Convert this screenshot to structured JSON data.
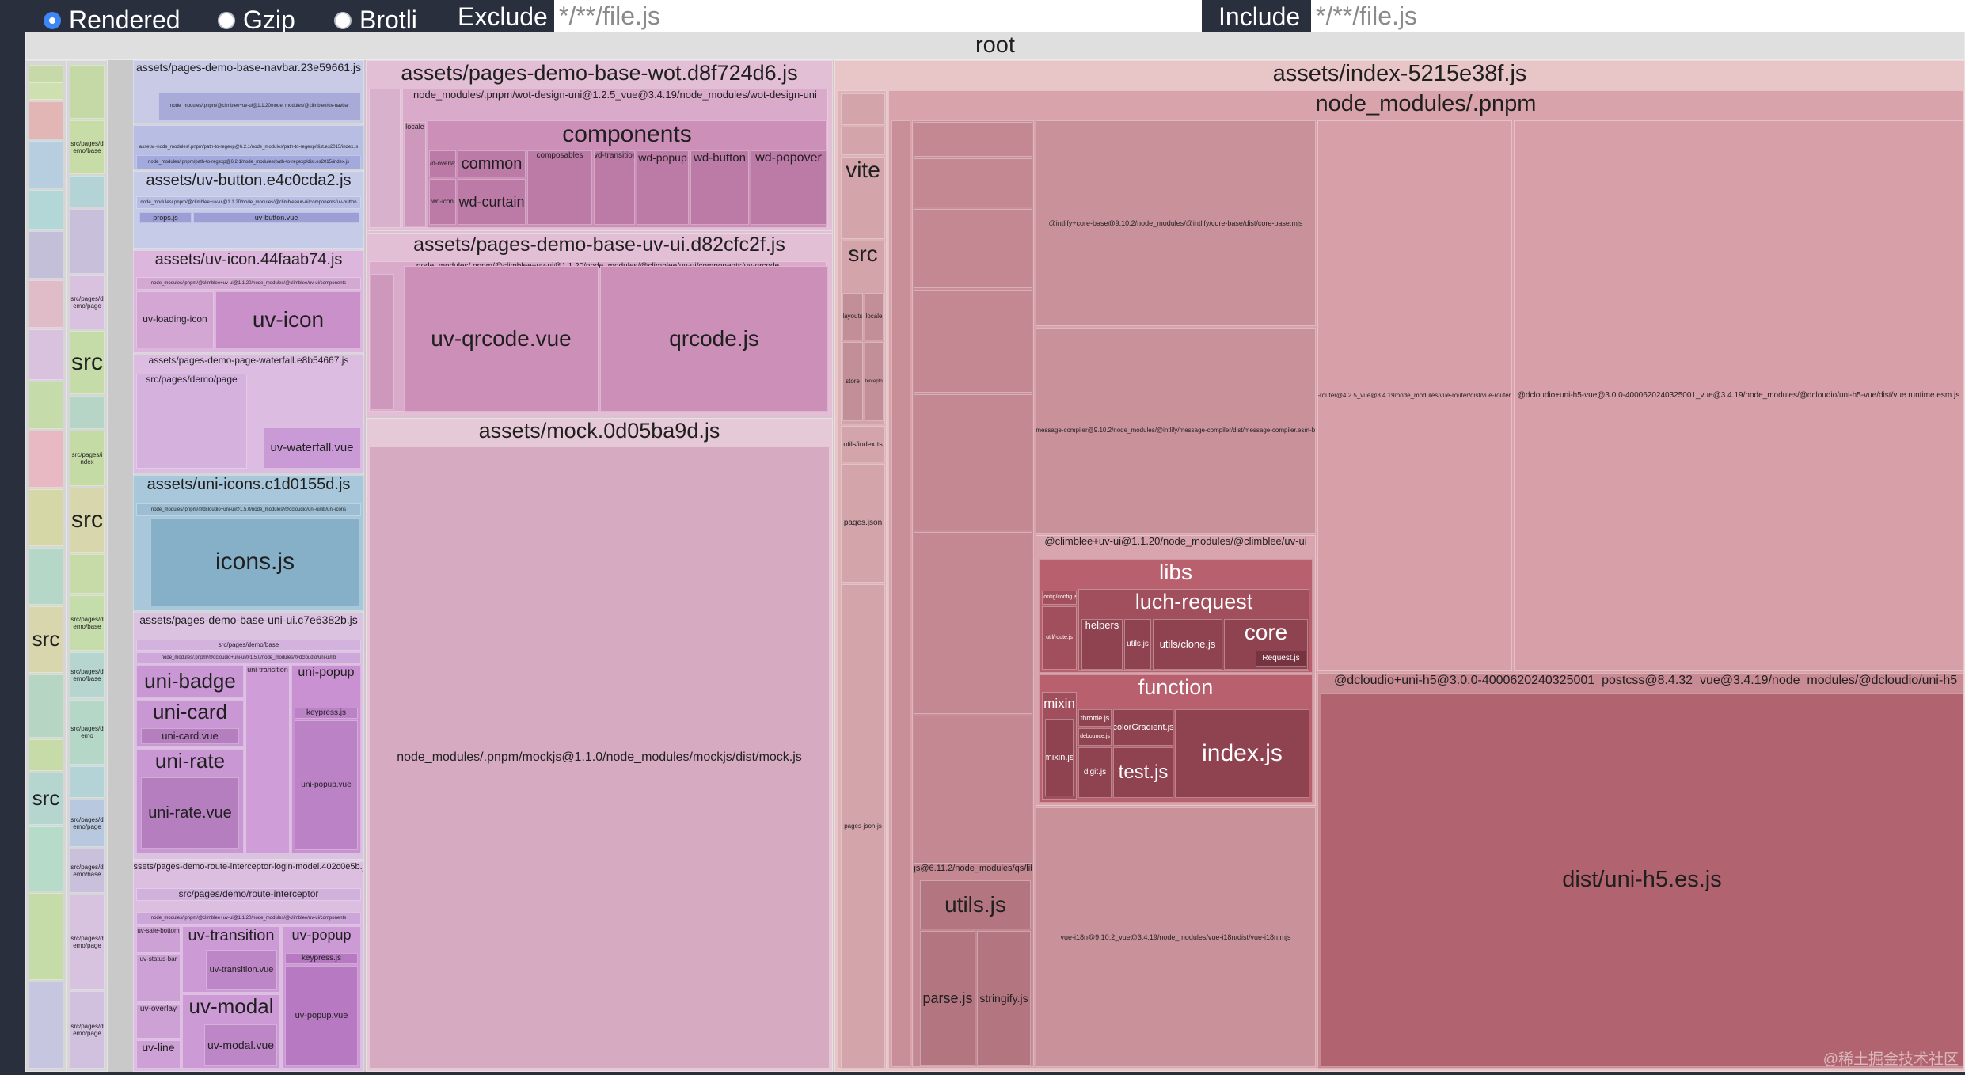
{
  "toolbar": {
    "modes": [
      {
        "label": "Rendered",
        "selected": true
      },
      {
        "label": "Gzip",
        "selected": false
      },
      {
        "label": "Brotli",
        "selected": false
      }
    ],
    "exclude_label": "Exclude",
    "exclude_placeholder": "*/**/file.js",
    "include_label": "Include",
    "include_placeholder": "*/**/file.js"
  },
  "treemap": {
    "root": "root",
    "left_columns": {
      "src_labels": [
        "src",
        "src",
        "src",
        "src"
      ],
      "col2_items": [
        "src/pages/demo/base",
        "src/pages/demo/page",
        "src/pages/index",
        "src/pages/demo/base",
        "src/pages/demo/base",
        "src/pages/demo",
        "src/pages/demo/page",
        "src/pages/demo/base",
        "src/pages/demo/page",
        "src/pages/index",
        "src/pages/demo/page"
      ]
    },
    "col3": {
      "navbar": {
        "title": "assets/pages-demo-base-navbar.23e59661.js",
        "sub1": "node_modules/.pnpm/@climblee+uv-ui@1.1.20/node_modules/@climblee/uv-navbar",
        "sub2": "assets/~node_modules/.pnpm/path-to-regexp@6.2.1/node_modules/path-to-regexp/dist.es2015/index.js",
        "sub3": "node_modules/.pnpm/path-to-regexp@6.2.1/node_modules/path-to-regexp/dist.es2015/index.js"
      },
      "uv_button": {
        "title": "assets/uv-button.e4c0cda2.js",
        "sub": "node_modules/.pnpm/@climblee+uv-ui@1.1.20/node_modules/@climblee/uv-ui/components/uv-button",
        "props": "props.js",
        "vue": "uv-button.vue"
      },
      "uv_icon": {
        "title": "assets/uv-icon.44faab74.js",
        "sub": "node_modules/.pnpm/@climblee+uv-ui@1.1.20/node_modules/@climblee/uv-ui/components",
        "loading": "uv-loading-icon",
        "icon": "uv-icon"
      },
      "waterfall": {
        "title": "assets/pages-demo-page-waterfall.e8b54667.js",
        "sub": "src/pages/demo/page",
        "item": "uv-waterfall.vue"
      },
      "uni_icons": {
        "title": "assets/uni-icons.c1d0155d.js",
        "sub": "node_modules/.pnpm/@dcloudio+uni-ui@1.5.0/node_modules/@dcloudio/uni-ui/lib/uni-icons",
        "item": "icons.js"
      },
      "uni_ui": {
        "title": "assets/pages-demo-base-uni-ui.c7e6382b.js",
        "sub": "src/pages/demo/base",
        "sub2": "node_modules/.pnpm/@dcloudio+uni-ui@1.5.0/node_modules/@dcloudio/uni-ui/lib",
        "badge": "uni-badge",
        "card": "uni-card",
        "card_vue": "uni-card.vue",
        "rate": "uni-rate",
        "rate_vue": "uni-rate.vue",
        "transition": "uni-transition",
        "popup": "uni-popup",
        "keypress": "keypress.js",
        "popup_vue": "uni-popup.vue"
      },
      "route": {
        "title": "assets/pages-demo-route-interceptor-login-model.402c0e5b.js",
        "sub": "src/pages/demo/route-interceptor",
        "sub2": "node_modules/.pnpm/@climblee+uv-ui@1.1.20/node_modules/@climblee/uv-ui/components",
        "safe": "uv-safe-bottom",
        "status": "uv-status-bar",
        "overlay": "uv-overlay",
        "line": "uv-line",
        "transition": "uv-transition",
        "transition_vue": "uv-transition.vue",
        "modal": "uv-modal",
        "modal_vue": "uv-modal.vue",
        "popup": "uv-popup",
        "keypress": "keypress.js",
        "popup_vue": "uv-popup.vue"
      }
    },
    "col4": {
      "wot": {
        "title": "assets/pages-demo-base-wot.d8f724d6.js",
        "sub": "node_modules/.pnpm/wot-design-uni@1.2.5_vue@3.4.19/node_modules/wot-design-uni",
        "locale": "locale",
        "components": "components",
        "common": "common",
        "curtain": "wd-curtain",
        "composables": "composables",
        "transition": "wd-transition",
        "popup": "wd-popup",
        "button": "wd-button",
        "popover": "wd-popover",
        "icon": "wd-icon",
        "overlay": "wd-overlay"
      },
      "uvui": {
        "title": "assets/pages-demo-base-uv-ui.d82cfc2f.js",
        "sub": "node_modules/.pnpm/@climblee+uv-ui@1.1.20/node_modules/@climblee/uv-ui/components/uv-qrcode",
        "qrvue": "uv-qrcode.vue",
        "qrjs": "qrcode.js"
      },
      "mock": {
        "title": "assets/mock.0d05ba9d.js",
        "path": "node_modules/.pnpm/mockjs@1.1.0/node_modules/mockjs/dist/mock.js"
      }
    },
    "index": {
      "title": "assets/index-5215e38f.js",
      "pnpm": "node_modules/.pnpm",
      "vite": "vite",
      "src": "src",
      "layouts": "layouts",
      "locale": "locale",
      "store": "store",
      "interceptors": "interceptors",
      "utils_index": "utils/index.ts",
      "pages_json": "pages.json",
      "pages_json_js": "pages-json-js",
      "core_base": "@intlify+core-base@9.10.2/node_modules/@intlify/core-base/dist/core-base.mjs",
      "msg_compiler": "@intlify+message-compiler@9.10.2/node_modules/@intlify/message-compiler/dist/message-compiler.esm-browser.js",
      "vue_router": "vue-router@4.2.5_vue@3.4.19/node_modules/vue-router/dist/vue-router.mjs",
      "runtime": "@dcloudio+uni-h5-vue@3.0.0-4000620240325001_vue@3.4.19/node_modules/@dcloudio/uni-h5-vue/dist/vue.runtime.esm.js",
      "climblee": "@climblee+uv-ui@1.1.20/node_modules/@climblee/uv-ui",
      "libs": "libs",
      "luch": "luch-request",
      "config": "config/config.js",
      "utils_route": "util/route.js",
      "helpers": "helpers",
      "utils_js": "utils.js",
      "clone": "utils/clone.js",
      "core": "core",
      "request": "Request.js",
      "function": "function",
      "mixin": "mixin",
      "mixin_js": "mixin.js",
      "throttle": "throttle.js",
      "debounce": "debounce.js",
      "color": "colorGradient.js",
      "digit": "digit.js",
      "test": "test.js",
      "index_js": "index.js",
      "vue_i18n": "vue-i18n@9.10.2_vue@3.4.19/node_modules/vue-i18n/dist/vue-i18n.mjs",
      "qs": "qs@6.11.2/node_modules/qs/lib",
      "qs_utils": "utils.js",
      "qs_parse": "parse.js",
      "qs_stringify": "stringify.js",
      "uni_h5": "@dcloudio+uni-h5@3.0.0-4000620240325001_postcss@8.4.32_vue@3.4.19/node_modules/@dcloudio/uni-h5",
      "uni_h5_dist": "dist/uni-h5.es.js"
    },
    "watermark": "@稀土掘金技术社区"
  }
}
